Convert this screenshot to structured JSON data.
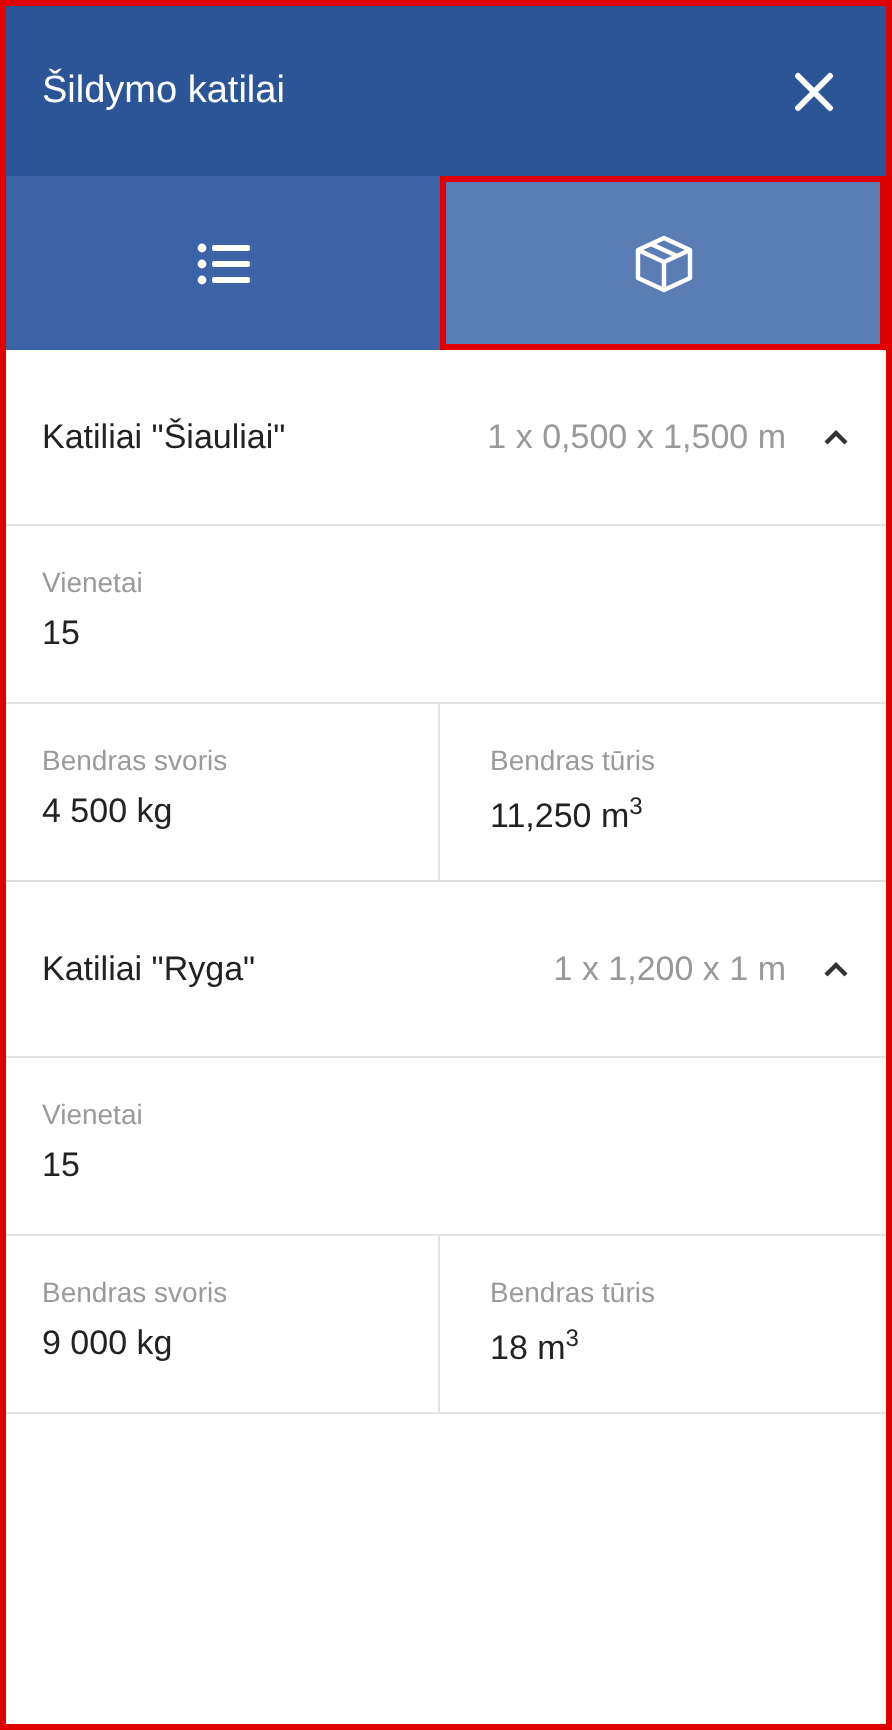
{
  "window": {
    "title": "Šildymo katilai"
  },
  "tabs": [
    {
      "kind": "list",
      "selected": false
    },
    {
      "kind": "box",
      "selected": true
    }
  ],
  "groups": [
    {
      "title": "Katiliai \"Šiauliai\"",
      "dimensions": "1 x 0,500 x 1,500 m",
      "expanded": true,
      "units_label": "Vienetai",
      "units": "15",
      "weight_label": "Bendras svoris",
      "weight": "4 500 kg",
      "volume_label": "Bendras tūris",
      "volume": "11,250 m$^{3}$"
    },
    {
      "title": "Katiliai \"Ryga\"",
      "dimensions": "1 x 1,200 x 1 m",
      "expanded": true,
      "units_label": "Vienetai",
      "units": "15",
      "weight_label": "Bendras svoris",
      "weight": "9 000 kg",
      "volume_label": "Bendras tūris",
      "volume": "18 m$^{3}$"
    }
  ]
}
